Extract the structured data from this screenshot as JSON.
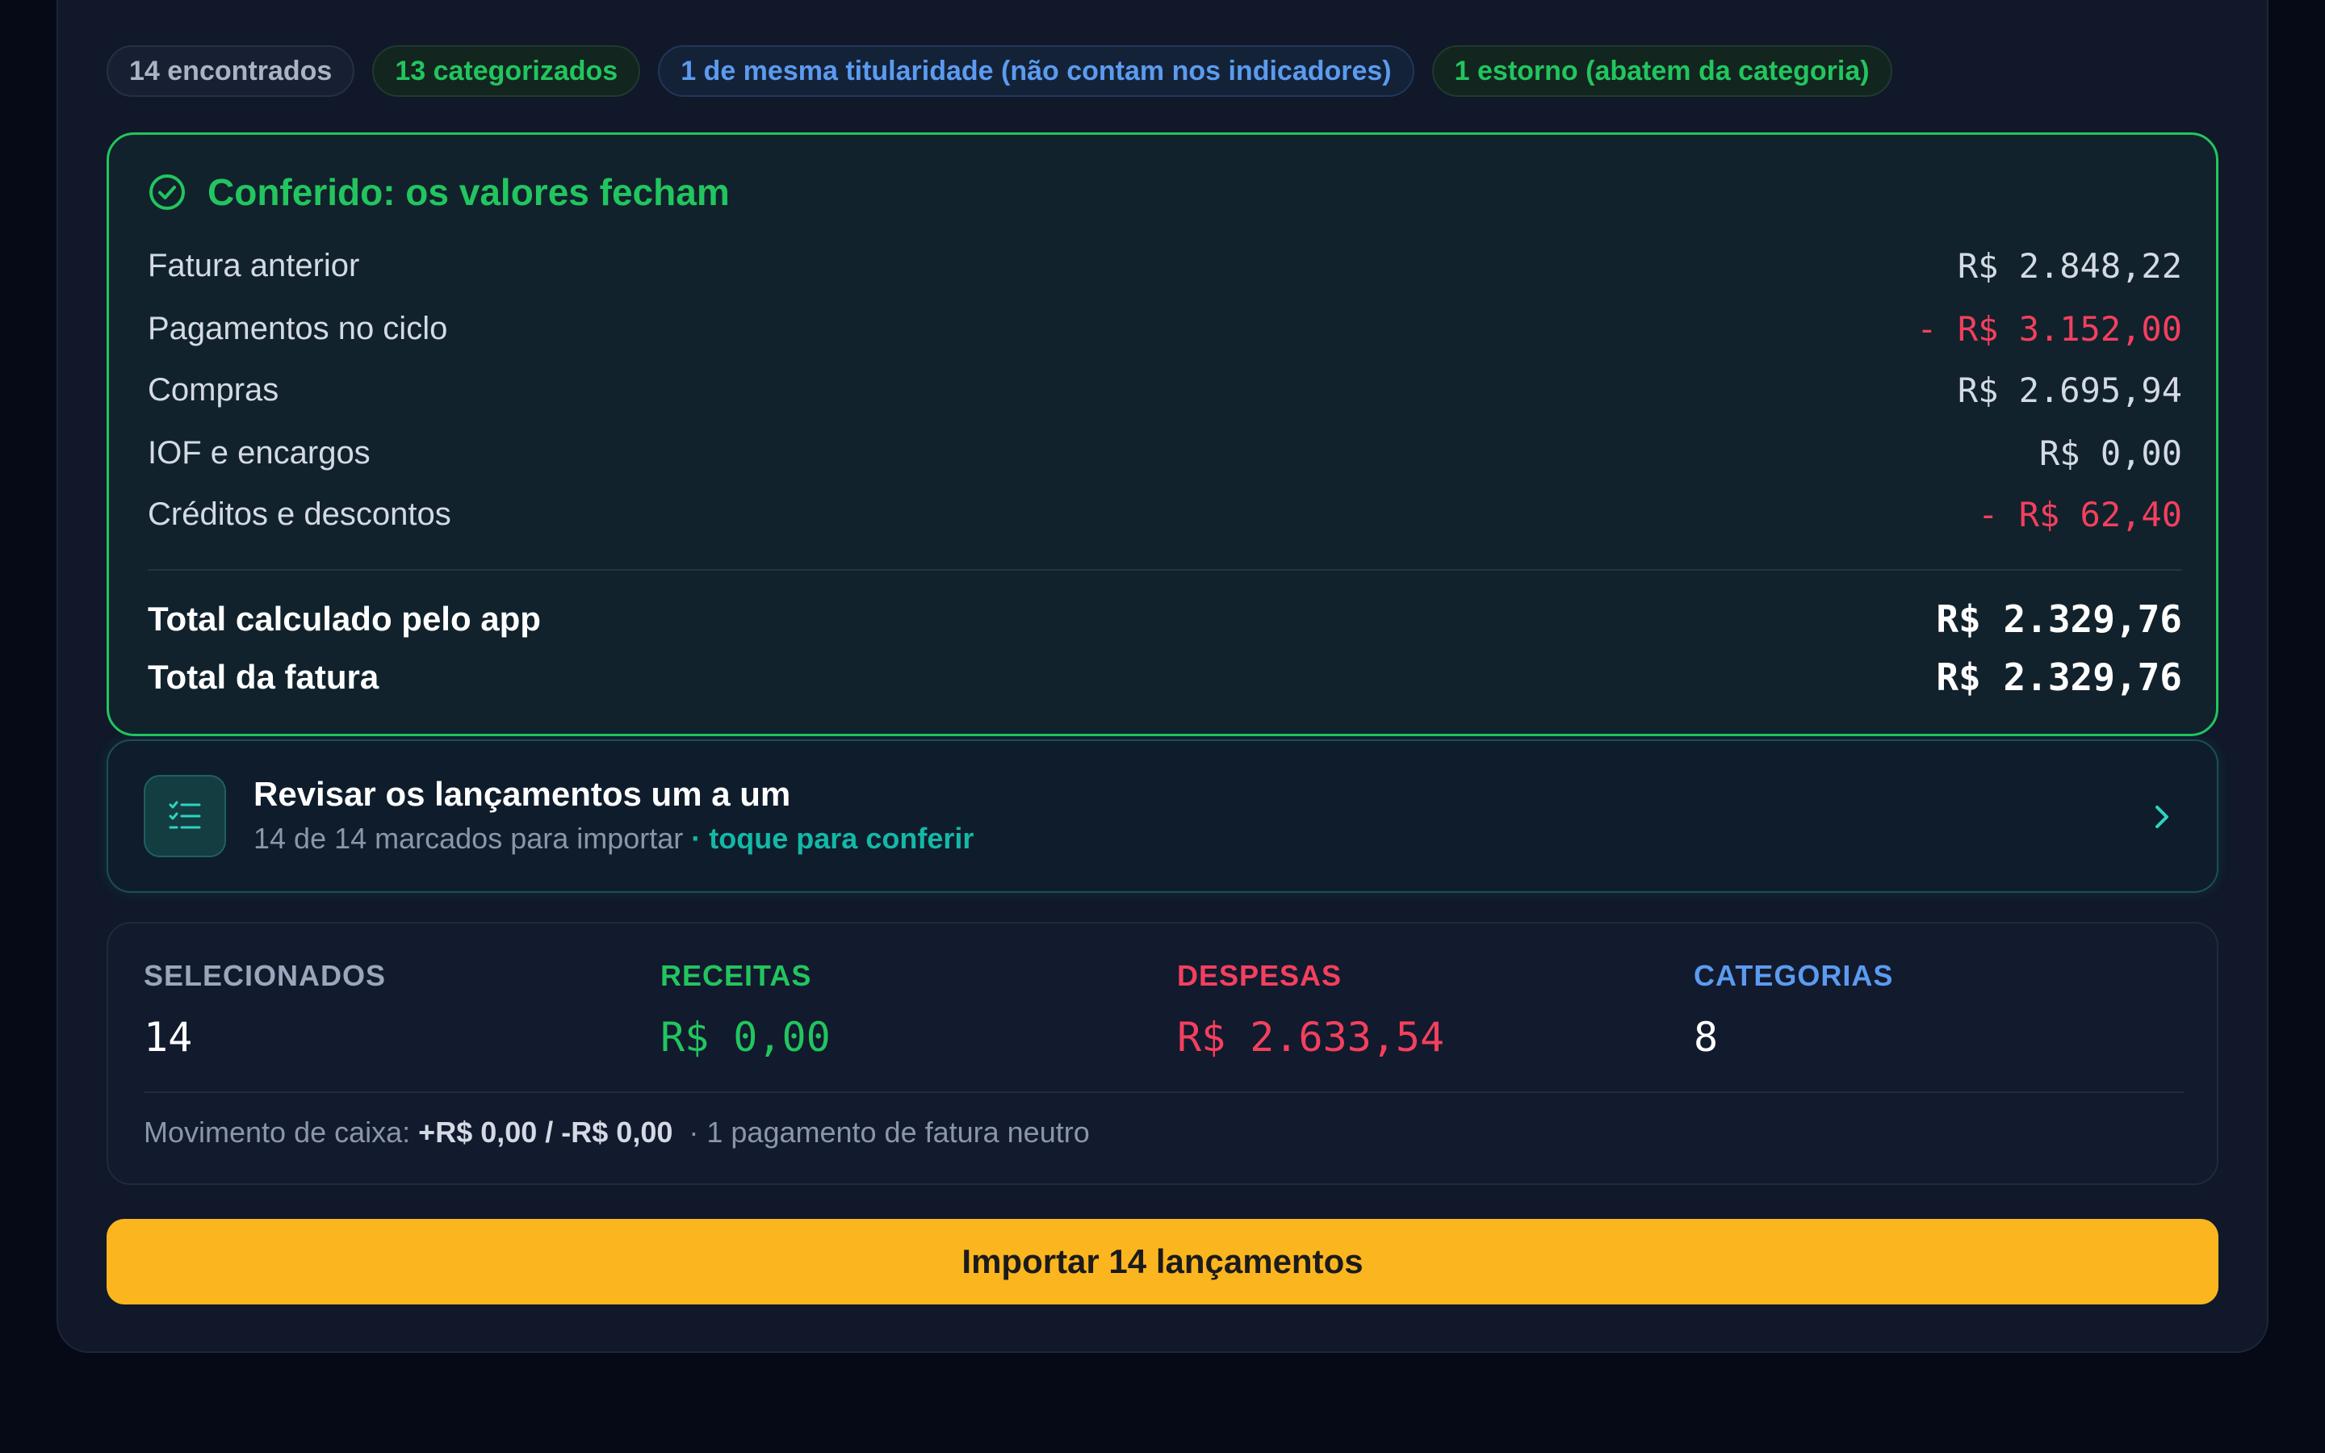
{
  "chips": [
    {
      "label": "14 encontrados"
    },
    {
      "label": "13 categorizados"
    },
    {
      "label": "1 de mesma titularidade (não contam nos indicadores)"
    },
    {
      "label": "1 estorno (abatem da categoria)"
    }
  ],
  "reconciliation": {
    "title": "Conferido: os valores fecham",
    "status_icon": "check-circle-icon",
    "rows": [
      {
        "label": "Fatura anterior",
        "value": "R$ 2.848,22"
      },
      {
        "label": "Pagamentos no ciclo",
        "value": "- R$ 3.152,00"
      },
      {
        "label": "Compras",
        "value": "R$ 2.695,94"
      },
      {
        "label": "IOF e encargos",
        "value": "R$ 0,00"
      },
      {
        "label": "Créditos e descontos",
        "value": "- R$ 62,40"
      }
    ],
    "totals": [
      {
        "label": "Total calculado pelo app",
        "value": "R$ 2.329,76"
      },
      {
        "label": "Total da fatura",
        "value": "R$ 2.329,76"
      }
    ]
  },
  "review": {
    "title": "Revisar os lançamentos um a um",
    "subtitle": "14 de 14 marcados para importar",
    "separator": " · ",
    "cta": "toque para conferir",
    "icon": "checklist-icon"
  },
  "stats": {
    "items": [
      {
        "label": "SELECIONADOS",
        "value": "14"
      },
      {
        "label": "RECEITAS",
        "value": "R$ 0,00"
      },
      {
        "label": "DESPESAS",
        "value": "R$ 2.633,54"
      },
      {
        "label": "CATEGORIAS",
        "value": "8"
      }
    ],
    "cash_label": "Movimento de caixa:",
    "cash_value": "+R$ 0,00 / -R$ 0,00",
    "cash_note": "· 1 pagamento de fatura neutro"
  },
  "import_button": "Importar 14 lançamentos",
  "colors": {
    "accent_green": "#22c55e",
    "accent_red": "#f43f5e",
    "accent_blue": "#5b9bf0",
    "accent_teal": "#14b8a6",
    "button_yellow": "#fbb51f"
  }
}
